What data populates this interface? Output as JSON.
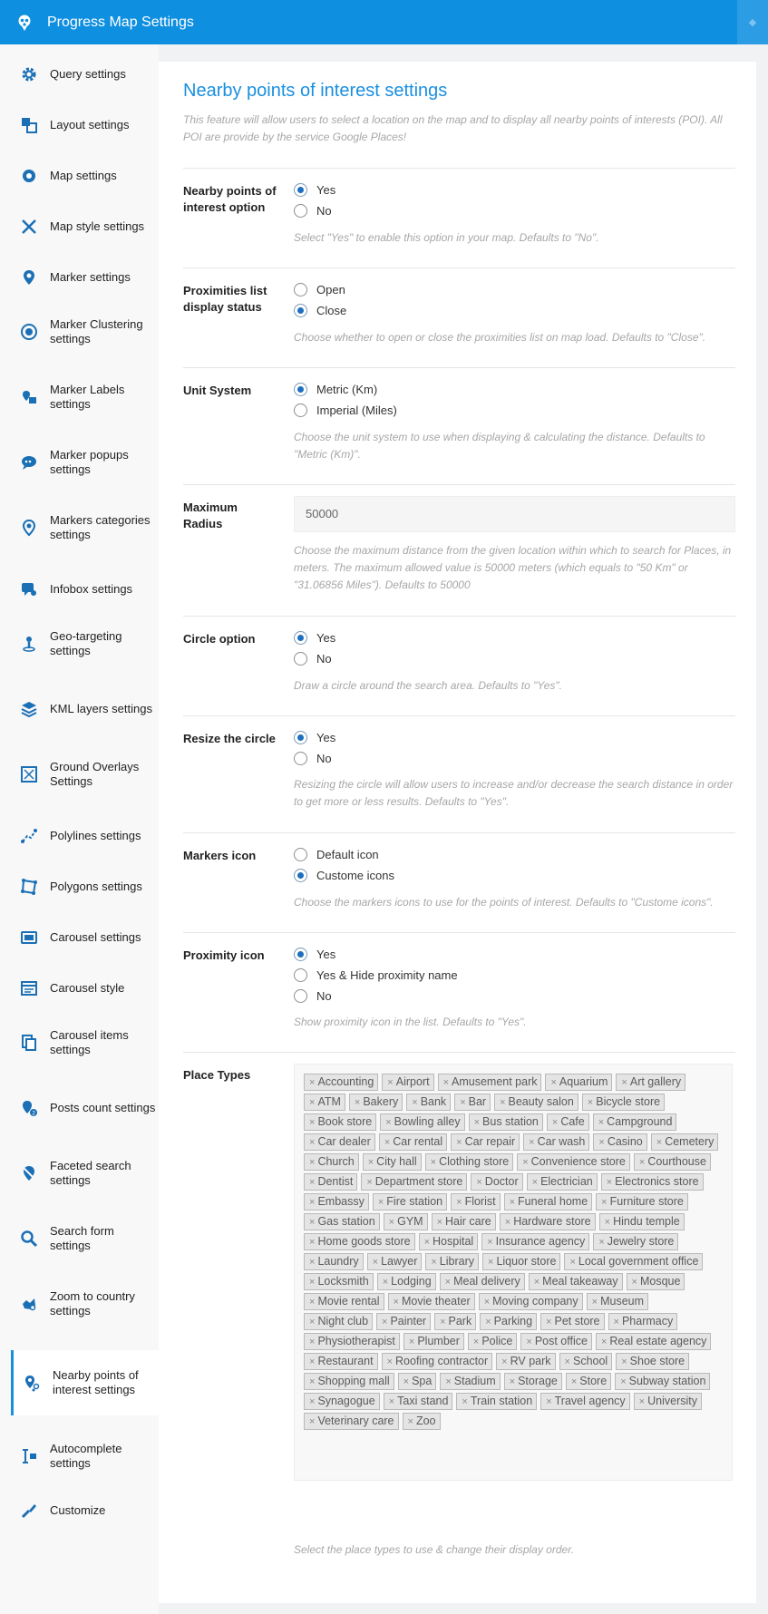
{
  "topbar": {
    "title": "Progress Map Settings"
  },
  "sidebar": {
    "items": [
      {
        "label": "Query settings",
        "icon": "gear-icon"
      },
      {
        "label": "Layout settings",
        "icon": "layout-icon"
      },
      {
        "label": "Map settings",
        "icon": "map-gear-icon"
      },
      {
        "label": "Map style settings",
        "icon": "brush-icon"
      },
      {
        "label": "Marker settings",
        "icon": "marker-icon"
      },
      {
        "label": "Marker Clustering settings",
        "icon": "cluster-icon"
      },
      {
        "label": "Marker Labels settings",
        "icon": "marker-label-icon"
      },
      {
        "label": "Marker popups settings",
        "icon": "popup-icon"
      },
      {
        "label": "Markers categories settings",
        "icon": "category-marker-icon"
      },
      {
        "label": "Infobox settings",
        "icon": "infobox-icon"
      },
      {
        "label": "Geo-targeting settings",
        "icon": "geotarget-icon"
      },
      {
        "label": "KML layers settings",
        "icon": "layers-icon"
      },
      {
        "label": "Ground Overlays Settings",
        "icon": "overlay-icon"
      },
      {
        "label": "Polylines settings",
        "icon": "polyline-icon"
      },
      {
        "label": "Polygons settings",
        "icon": "polygon-icon"
      },
      {
        "label": "Carousel settings",
        "icon": "carousel-icon"
      },
      {
        "label": "Carousel style",
        "icon": "carousel-style-icon"
      },
      {
        "label": "Carousel items settings",
        "icon": "carousel-items-icon"
      },
      {
        "label": "Posts count settings",
        "icon": "posts-count-icon"
      },
      {
        "label": "Faceted search settings",
        "icon": "faceted-search-icon"
      },
      {
        "label": "Search form settings",
        "icon": "search-icon"
      },
      {
        "label": "Zoom to country settings",
        "icon": "zoom-country-icon"
      },
      {
        "label": "Nearby points of interest settings",
        "icon": "nearby-poi-icon"
      },
      {
        "label": "Autocomplete settings",
        "icon": "autocomplete-icon"
      },
      {
        "label": "Customize",
        "icon": "customize-icon"
      }
    ]
  },
  "main": {
    "title": "Nearby points of interest settings",
    "intro": "This feature will allow users to select a location on the map and to display all nearby points of interests (POI). All POI are provide by the service Google Places!",
    "fields": {
      "poi_option": {
        "label": "Nearby points of interest option",
        "options": [
          "Yes",
          "No"
        ],
        "selected": "Yes",
        "help": "Select \"Yes\" to enable this option in your map. Defaults to \"No\"."
      },
      "list_status": {
        "label": "Proximities list display status",
        "options": [
          "Open",
          "Close"
        ],
        "selected": "Close",
        "help": "Choose whether to open or close the proximities list on map load. Defaults to \"Close\"."
      },
      "unit_system": {
        "label": "Unit System",
        "options": [
          "Metric (Km)",
          "Imperial (Miles)"
        ],
        "selected": "Metric (Km)",
        "help": "Choose the unit system to use when displaying & calculating the distance. Defaults to \"Metric (Km)\"."
      },
      "max_radius": {
        "label": "Maximum Radius",
        "value": "50000",
        "help": "Choose the maximum distance from the given location within which to search for Places, in meters. The maximum allowed value is 50000 meters (which equals to \"50 Km\" or \"31.06856 Miles\"). Defaults to 50000"
      },
      "circle_option": {
        "label": "Circle option",
        "options": [
          "Yes",
          "No"
        ],
        "selected": "Yes",
        "help": "Draw a circle around the search area. Defaults to \"Yes\"."
      },
      "resize_circle": {
        "label": "Resize the circle",
        "options": [
          "Yes",
          "No"
        ],
        "selected": "Yes",
        "help": "Resizing the circle will allow users to increase and/or decrease the search distance in order to get more or less results. Defaults to \"Yes\"."
      },
      "markers_icon": {
        "label": "Markers icon",
        "options": [
          "Default icon",
          "Custome icons"
        ],
        "selected": "Custome icons",
        "help": "Choose the markers icons to use for the points of interest. Defaults to \"Custome icons\"."
      },
      "proximity_icon": {
        "label": "Proximity icon",
        "options": [
          "Yes",
          "Yes & Hide proximity name",
          "No"
        ],
        "selected": "Yes",
        "help": "Show proximity icon in the list. Defaults to \"Yes\"."
      },
      "place_types": {
        "label": "Place Types",
        "help": "Select the place types to use & change their display order.",
        "tags": [
          "Accounting",
          "Airport",
          "Amusement park",
          "Aquarium",
          "Art gallery",
          "ATM",
          "Bakery",
          "Bank",
          "Bar",
          "Beauty salon",
          "Bicycle store",
          "Book store",
          "Bowling alley",
          "Bus station",
          "Cafe",
          "Campground",
          "Car dealer",
          "Car rental",
          "Car repair",
          "Car wash",
          "Casino",
          "Cemetery",
          "Church",
          "City hall",
          "Clothing store",
          "Convenience store",
          "Courthouse",
          "Dentist",
          "Department store",
          "Doctor",
          "Electrician",
          "Electronics store",
          "Embassy",
          "Fire station",
          "Florist",
          "Funeral home",
          "Furniture store",
          "Gas station",
          "GYM",
          "Hair care",
          "Hardware store",
          "Hindu temple",
          "Home goods store",
          "Hospital",
          "Insurance agency",
          "Jewelry store",
          "Laundry",
          "Lawyer",
          "Library",
          "Liquor store",
          "Local government office",
          "Locksmith",
          "Lodging",
          "Meal delivery",
          "Meal takeaway",
          "Mosque",
          "Movie rental",
          "Movie theater",
          "Moving company",
          "Museum",
          "Night club",
          "Painter",
          "Park",
          "Parking",
          "Pet store",
          "Pharmacy",
          "Physiotherapist",
          "Plumber",
          "Police",
          "Post office",
          "Real estate agency",
          "Restaurant",
          "Roofing contractor",
          "RV park",
          "School",
          "Shoe store",
          "Shopping mall",
          "Spa",
          "Stadium",
          "Storage",
          "Store",
          "Subway station",
          "Synagogue",
          "Taxi stand",
          "Train station",
          "Travel agency",
          "University",
          "Veterinary care",
          "Zoo"
        ]
      }
    }
  },
  "colors": {
    "accent": "#0f8fe0",
    "radio_checked": "#1e6fbe",
    "help_text": "#a7a7a7"
  }
}
